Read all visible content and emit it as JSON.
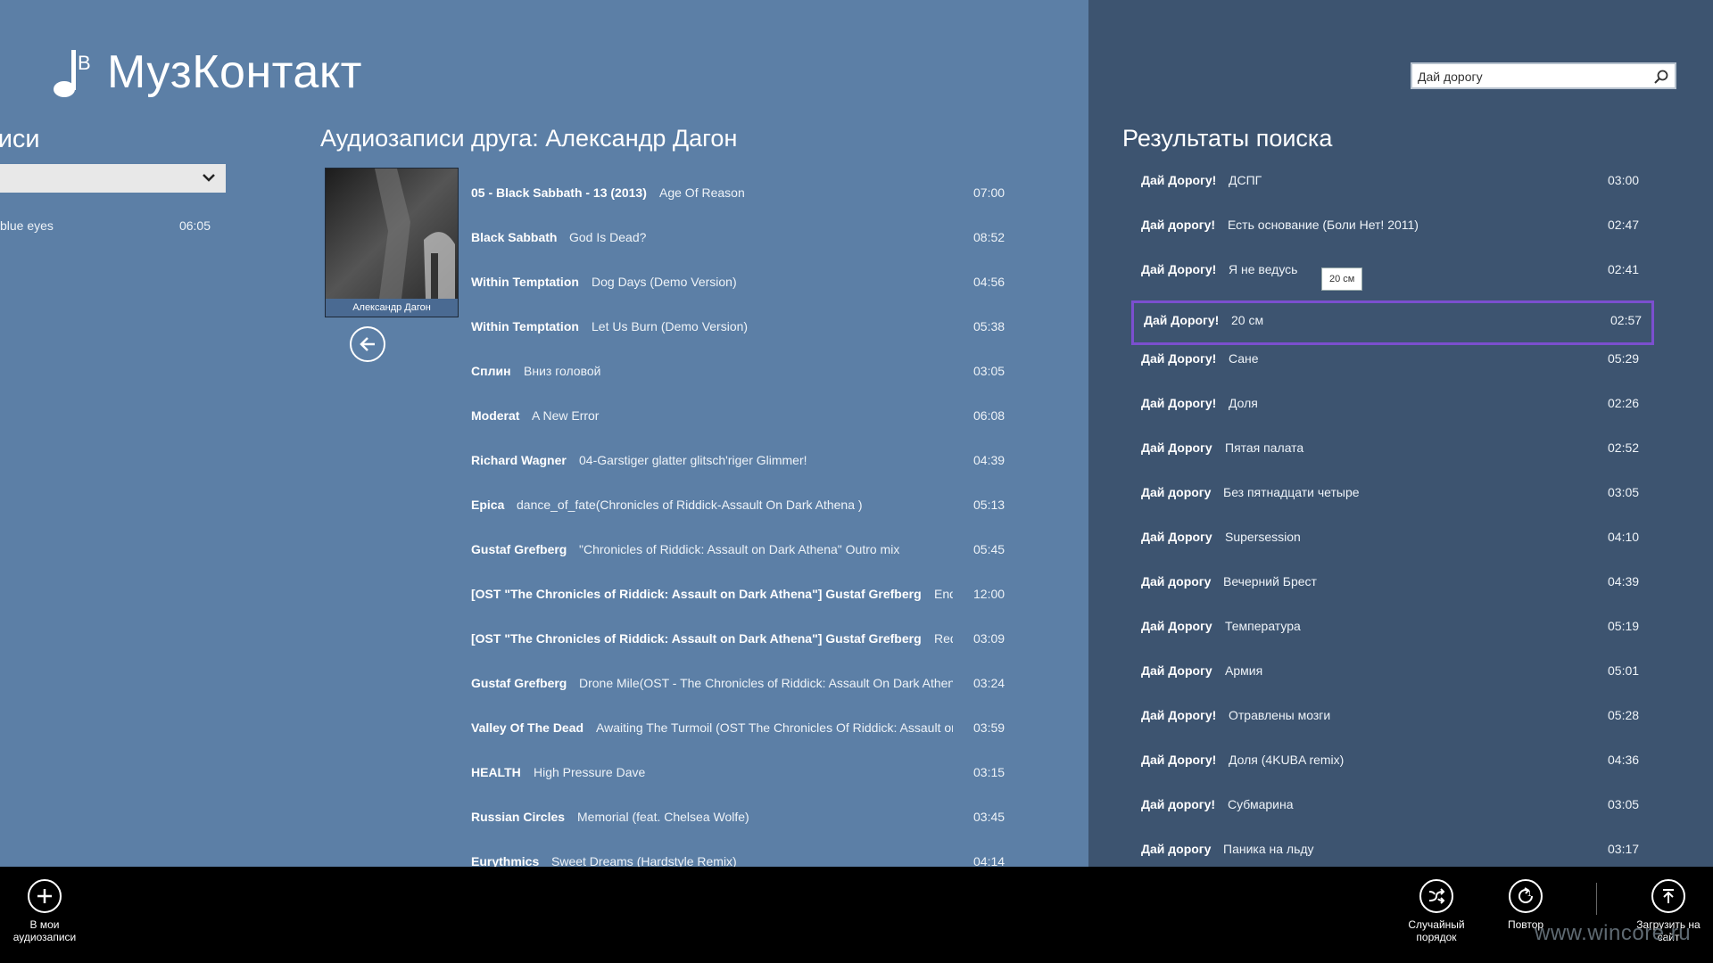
{
  "app": {
    "title": "МузКонтакт"
  },
  "my_audio": {
    "header": "писи",
    "selected_value": "",
    "track": {
      "title": "blue eyes",
      "duration": "06:05"
    }
  },
  "friend": {
    "header": "Аудиозаписи друга: Александр Дагон",
    "name": "Александр Дагон",
    "tracks": [
      {
        "artist": "05 - Black Sabbath - 13 (2013)",
        "title": "Age Of Reason",
        "duration": "07:00"
      },
      {
        "artist": "Black Sabbath",
        "title": "God Is Dead?",
        "duration": "08:52"
      },
      {
        "artist": "Within Temptation",
        "title": "Dog Days (Demo Version)",
        "duration": "04:56"
      },
      {
        "artist": "Within Temptation",
        "title": "Let Us Burn (Demo Version)",
        "duration": "05:38"
      },
      {
        "artist": "Сплин",
        "title": "Вниз головой",
        "duration": "03:05"
      },
      {
        "artist": "Moderat",
        "title": "A New Error",
        "duration": "06:08"
      },
      {
        "artist": "Richard Wagner",
        "title": "04-Garstiger glatter glitsch'riger Glimmer!",
        "duration": "04:39"
      },
      {
        "artist": "Epica",
        "title": "dance_of_fate(Chronicles of Riddick-Assault On Dark Athena )",
        "duration": "05:13"
      },
      {
        "artist": "Gustaf Grefberg",
        "title": "\"Chronicles of Riddick: Assault on Dark Athena\" Outro mix",
        "duration": "05:45"
      },
      {
        "artist": "[OST \"The Chronicles of Riddick: Assault on Dark Athena\"] Gustaf Grefberg",
        "title": "End C",
        "duration": "12:00"
      },
      {
        "artist": "[OST \"The Chronicles of Riddick: Assault on Dark Athena\"] Gustaf Grefberg",
        "title": "Red A",
        "duration": "03:09"
      },
      {
        "artist": "Gustaf Grefberg",
        "title": "Drone Mile(OST - The Chronicles of Riddick: Assault On Dark Athena",
        "duration": "03:24"
      },
      {
        "artist": "Valley Of The Dead",
        "title": "Awaiting The Turmoil (OST The Chronicles Of Riddick: Assault on",
        "duration": "03:59"
      },
      {
        "artist": "HEALTH",
        "title": "High Pressure Dave",
        "duration": "03:15"
      },
      {
        "artist": "Russian Circles",
        "title": "Memorial (feat. Chelsea Wolfe)",
        "duration": "03:45"
      },
      {
        "artist": "Eurythmics",
        "title": "Sweet Dreams (Hardstyle Remix)",
        "duration": "04:14"
      }
    ]
  },
  "search": {
    "value": "Дай дорогу",
    "header": "Результаты поиска",
    "tooltip": "20 см",
    "results": [
      {
        "artist": "Дай Дорогу!",
        "title": "ДСПГ",
        "duration": "03:00"
      },
      {
        "artist": "Дай дорогу!",
        "title": "Есть основание (Боли Нет! 2011)",
        "duration": "02:47"
      },
      {
        "artist": "Дай Дорогу!",
        "title": "Я не ведусь",
        "duration": "02:41"
      },
      {
        "artist": "Дай Дорогу!",
        "title": "20 см",
        "duration": "02:57"
      },
      {
        "artist": "Дай Дорогу!",
        "title": "Сане",
        "duration": "05:29"
      },
      {
        "artist": "Дай Дорогу!",
        "title": "Доля",
        "duration": "02:26"
      },
      {
        "artist": "Дай Дорогу",
        "title": "Пятая палата",
        "duration": "02:52"
      },
      {
        "artist": "Дай дорогу",
        "title": "Без пятнадцати четыре",
        "duration": "03:05"
      },
      {
        "artist": "Дай Дорогу",
        "title": "Supersession",
        "duration": "04:10"
      },
      {
        "artist": "Дай дорогу",
        "title": "Вечерний Брест",
        "duration": "04:39"
      },
      {
        "artist": "Дай Дорогу",
        "title": "Температура",
        "duration": "05:19"
      },
      {
        "artist": "Дай Дорогу",
        "title": "Армия",
        "duration": "05:01"
      },
      {
        "artist": "Дай Дорогу!",
        "title": "Отравлены мозги",
        "duration": "05:28"
      },
      {
        "artist": "Дай Дорогу!",
        "title": "Доля (4KUBA remix)",
        "duration": "04:36"
      },
      {
        "artist": "Дай дорогу!",
        "title": "Субмарина",
        "duration": "03:05"
      },
      {
        "artist": "Дай дорогу",
        "title": "Паника на льду",
        "duration": "03:17"
      }
    ]
  },
  "appbar": {
    "add": {
      "label": "В мои аудиозаписи",
      "icon": "plus-icon"
    },
    "shuffle": {
      "label": "Случайный порядок",
      "icon": "shuffle-icon"
    },
    "repeat": {
      "label": "Повтор",
      "icon": "repeat-icon"
    },
    "upload": {
      "label": "Загрузить на сайт",
      "icon": "upload-icon"
    }
  },
  "watermark": "www.wincore.ru",
  "colors": {
    "left_bg": "#5c7fa6",
    "right_bg": "#3d5470",
    "appbar_bg": "#000000",
    "selection": "#7b4fcf"
  }
}
